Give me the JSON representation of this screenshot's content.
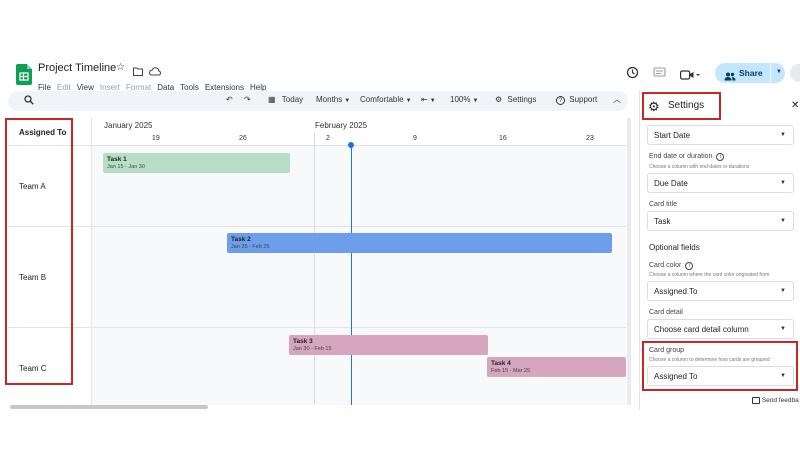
{
  "app": {
    "title": "Project Timeline"
  },
  "menu": [
    "File",
    "Edit",
    "View",
    "Insert",
    "Format",
    "Data",
    "Tools",
    "Extensions",
    "Help"
  ],
  "share": {
    "label": "Share"
  },
  "toolbar": {
    "today": "Today",
    "months": "Months",
    "comfortable": "Comfortable",
    "zoom": "100%",
    "settings": "Settings",
    "support": "Support"
  },
  "timeline": {
    "group_header": "Assigned To",
    "months": [
      "January 2025",
      "February 2025"
    ],
    "days": [
      "19",
      "26",
      "2",
      "9",
      "16",
      "23"
    ],
    "groups": [
      "Team A",
      "Team B",
      "Team C"
    ],
    "tasks": [
      {
        "name": "Task 1",
        "dates": "Jan 15 - Jan 30",
        "color": "#b7dfc7"
      },
      {
        "name": "Task 2",
        "dates": "Jan 25 - Feb 25",
        "color": "#6d9eeb"
      },
      {
        "name": "Task 3",
        "dates": "Jan 30 - Feb 15",
        "color": "#d5a6bd"
      },
      {
        "name": "Task 4",
        "dates": "Feb 15 - Mar 25",
        "color": "#d5a6bd"
      }
    ]
  },
  "settings_panel": {
    "title": "Settings",
    "start_date_value": "Start Date",
    "end_label": "End date or duration",
    "end_hint": "Choose a column with end dates or durations",
    "end_value": "Due Date",
    "card_title_label": "Card title",
    "card_title_value": "Task",
    "optional_fields": "Optional fields",
    "card_color_label": "Card color",
    "card_color_hint": "Choose a column where the card color originated from",
    "card_color_value": "Assigned To",
    "card_detail_label": "Card detail",
    "card_detail_value": "Choose card detail column",
    "card_group_label": "Card group",
    "card_group_hint": "Choose a column to determine how cards are grouped",
    "card_group_value": "Assigned To",
    "send_feedback": "Send feedba"
  },
  "colors": {
    "accent": "#1a73e8",
    "share_bg": "#c2e7ff",
    "annotation": "#c62828",
    "sheets_green": "#0f9d58"
  }
}
